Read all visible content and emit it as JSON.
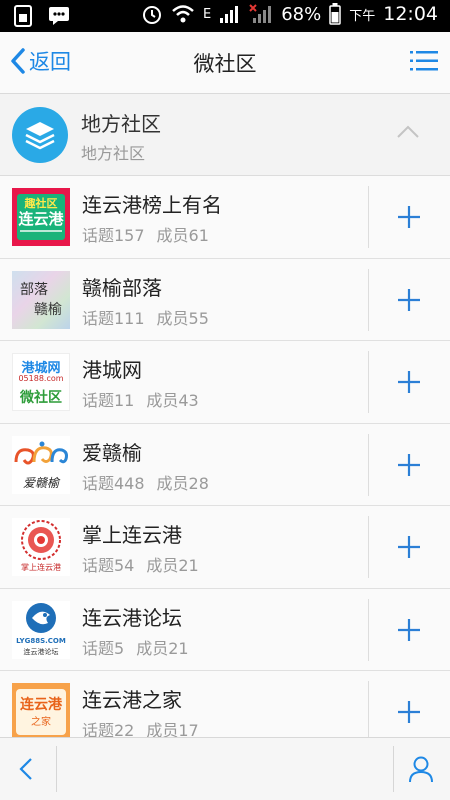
{
  "status_bar": {
    "battery": "68%",
    "ampm": "下午",
    "time": "12:04",
    "network_label": "E"
  },
  "nav": {
    "back_label": "返回",
    "title": "微社区"
  },
  "community": {
    "title": "地方社区",
    "subtitle": "地方社区"
  },
  "groups": [
    {
      "name": "连云港榜上有名",
      "topics": "话题157",
      "members": "成员61",
      "icon": "lianyungang-bang-logo"
    },
    {
      "name": "赣榆部落",
      "topics": "话题111",
      "members": "成员55",
      "icon": "ganyu-buluo-logo"
    },
    {
      "name": "港城网",
      "topics": "话题11",
      "members": "成员43",
      "icon": "gangcheng-logo"
    },
    {
      "name": "爱赣榆",
      "topics": "话题448",
      "members": "成员28",
      "icon": "ai-ganyu-logo"
    },
    {
      "name": "掌上连云港",
      "topics": "话题54",
      "members": "成员21",
      "icon": "zhangshang-logo"
    },
    {
      "name": "连云港论坛",
      "topics": "话题5",
      "members": "成员21",
      "icon": "lyg-luntan-logo"
    },
    {
      "name": "连云港之家",
      "topics": "话题22",
      "members": "成员17",
      "icon": "lyg-zhijia-logo"
    }
  ],
  "logos": {
    "bang_line1": "趣社区",
    "bang_line2": "连云港",
    "buluo_line1": "部落",
    "buluo_line2": "赣榆",
    "gangcheng_line1": "港城网",
    "gangcheng_line2": "05188.com",
    "gangcheng_line3": "微社区",
    "aiganyu_text": "爱赣榆",
    "zhangshang_text": "掌上连云港",
    "luntan_line1": "LYG88S.COM",
    "luntan_line2": "连云港论坛",
    "zhijia_line1": "连云港",
    "zhijia_line2": "之家"
  },
  "colors": {
    "accent": "#1e88e5",
    "community_icon": "#2aa9e6",
    "status_bar": "#000000"
  }
}
